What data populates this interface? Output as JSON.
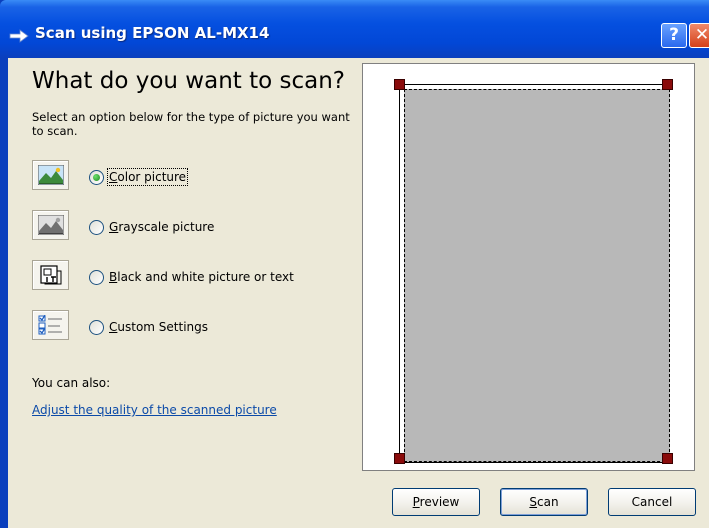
{
  "window": {
    "title": "Scan using EPSON AL-MX14",
    "help_glyph": "?",
    "close_glyph": "✕"
  },
  "main": {
    "heading": "What do you want to scan?",
    "description": "Select an option below for the type of picture you want to scan.",
    "options": [
      {
        "label": "Color picture",
        "accel": "C",
        "rest": "olor picture",
        "checked": true,
        "icon": "color-picture-icon"
      },
      {
        "label": "Grayscale picture",
        "accel": "G",
        "rest": "rayscale picture",
        "checked": false,
        "icon": "grayscale-picture-icon"
      },
      {
        "label": "Black and white picture or text",
        "accel": "B",
        "rest": "lack and white picture or text",
        "checked": false,
        "icon": "black-white-text-icon"
      },
      {
        "label": "Custom Settings",
        "accel": "C",
        "rest": "ustom Settings",
        "checked": false,
        "icon": "custom-settings-icon"
      }
    ],
    "also_label": "You can also:",
    "link_label": "Adjust the quality of the scanned picture"
  },
  "buttons": {
    "preview": {
      "label": "Preview",
      "accel": "P",
      "rest": "review"
    },
    "scan": {
      "label": "Scan",
      "accel": "S",
      "rest": "can"
    },
    "cancel": {
      "label": "Cancel"
    }
  },
  "colors": {
    "titlebar": "#0550e0",
    "dialog_bg": "#ece9d8",
    "handle": "#8a0b0b",
    "link": "#0b4aa8"
  }
}
